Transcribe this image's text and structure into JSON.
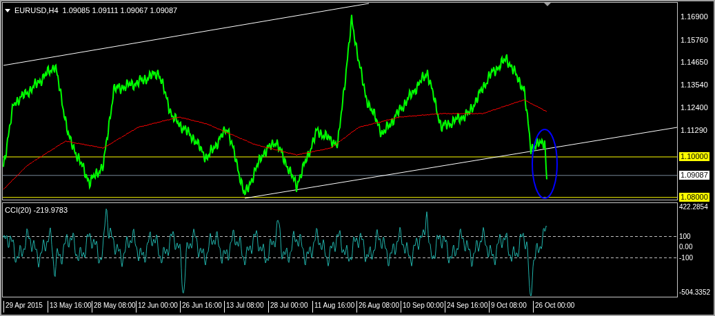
{
  "chart": {
    "symbol": "EURUSD,H4",
    "quote": "1.09085 1.09111 1.09067 1.09087",
    "price_axis": [
      {
        "label": "1.16900",
        "kind": "tick"
      },
      {
        "label": "1.15760",
        "kind": "tick"
      },
      {
        "label": "1.14650",
        "kind": "tick"
      },
      {
        "label": "1.13540",
        "kind": "tick"
      },
      {
        "label": "1.12400",
        "kind": "tick"
      },
      {
        "label": "1.11290",
        "kind": "tick"
      },
      {
        "label": "1.10000",
        "kind": "level"
      },
      {
        "label": "1.09087",
        "kind": "current"
      },
      {
        "label": "1.08000",
        "kind": "level"
      }
    ]
  },
  "indicator": {
    "title": "CCI(20) -219.9783",
    "axis": [
      {
        "label": "422.2854",
        "kind": "bound"
      },
      {
        "label": "100",
        "kind": "level"
      },
      {
        "label": "0.00",
        "kind": "tick"
      },
      {
        "label": "-100",
        "kind": "level"
      },
      {
        "label": "-504.3352",
        "kind": "bound"
      }
    ]
  },
  "time_axis": [
    "29 Apr 2015",
    "13 May 16:00",
    "28 May 08:00",
    "12 Jun 00:00",
    "26 Jun 16:00",
    "13 Jul 08:00",
    "28 Jul 00:00",
    "11 Aug 16:00",
    "26 Aug 08:00",
    "10 Sep 00:00",
    "24 Sep 16:00",
    "9 Oct 08:00",
    "26 Oct 00:00"
  ]
}
